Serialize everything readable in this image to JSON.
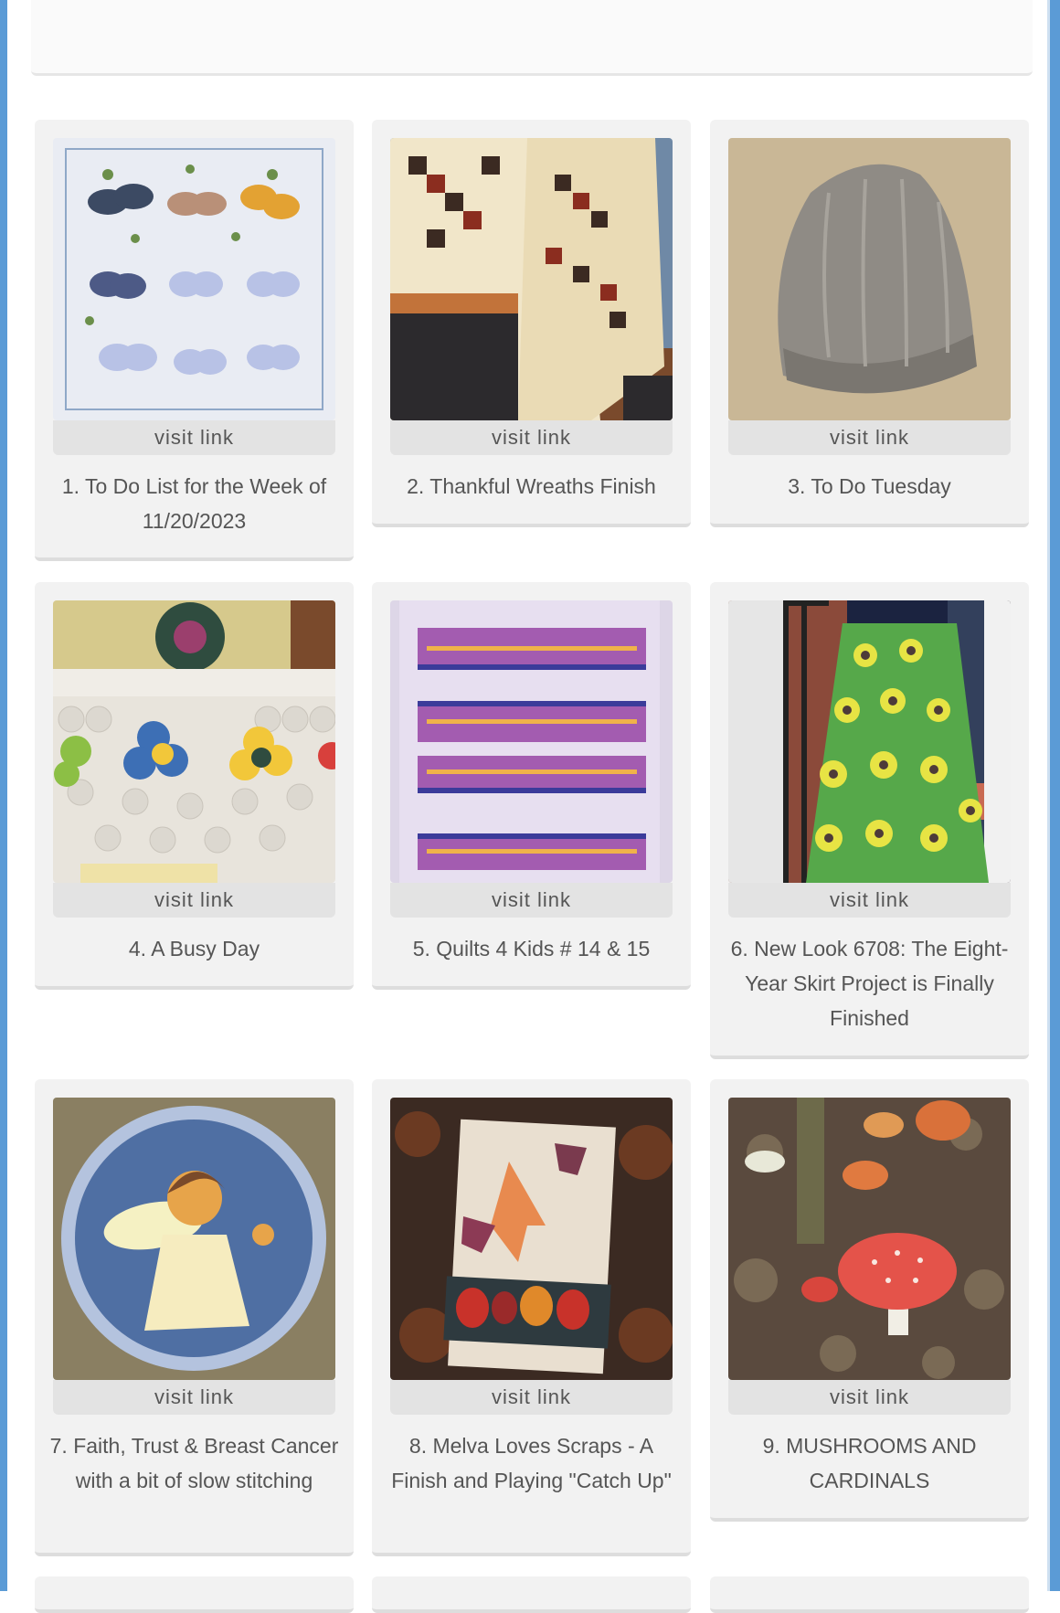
{
  "visit_label": "visit link",
  "cards": [
    {
      "title": "1. To Do List for the Week of 11/20/2023",
      "image": "butterfly-quilt"
    },
    {
      "title": "2. Thankful Wreaths Finish",
      "image": "chain-quilt"
    },
    {
      "title": "3. To Do Tuesday",
      "image": "knit-hat"
    },
    {
      "title": "4. A Busy Day",
      "image": "hexagon-quilt"
    },
    {
      "title": "5. Quilts 4 Kids # 14 & 15",
      "image": "striped-quilt"
    },
    {
      "title": "6. New Look 6708: The Eight-Year Skirt Project is Finally Finished",
      "image": "green-skirt"
    },
    {
      "title": "7. Faith, Trust & Breast Cancer with a bit of slow stitching",
      "image": "angel-applique"
    },
    {
      "title": "8. Melva Loves Scraps - A Finish and Playing \"Catch Up\"",
      "image": "leaf-quilt"
    },
    {
      "title": "9. MUSHROOMS AND CARDINALS",
      "image": "mushrooms"
    }
  ],
  "colors": {
    "frame": "#5b9bd6",
    "card": "#f2f2f2",
    "text": "#555555"
  }
}
